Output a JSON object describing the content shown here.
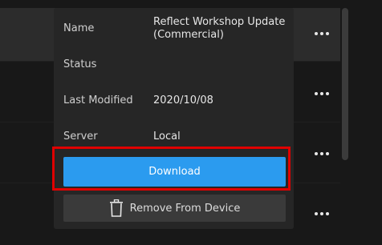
{
  "details": {
    "name_label": "Name",
    "name_value": "Reflect Workshop Update (Commercial)",
    "status_label": "Status",
    "status_value": "",
    "last_modified_label": "Last Modified",
    "last_modified_value": "2020/10/08",
    "server_label": "Server",
    "server_value": "Local"
  },
  "actions": {
    "download_label": "Download",
    "remove_label": "Remove From Device"
  },
  "icons": {
    "more": "more-horizontal-icon",
    "trash": "trash-icon"
  },
  "colors": {
    "accent": "#2b9bef",
    "highlight_border": "#e00000",
    "panel_bg": "#262626"
  }
}
